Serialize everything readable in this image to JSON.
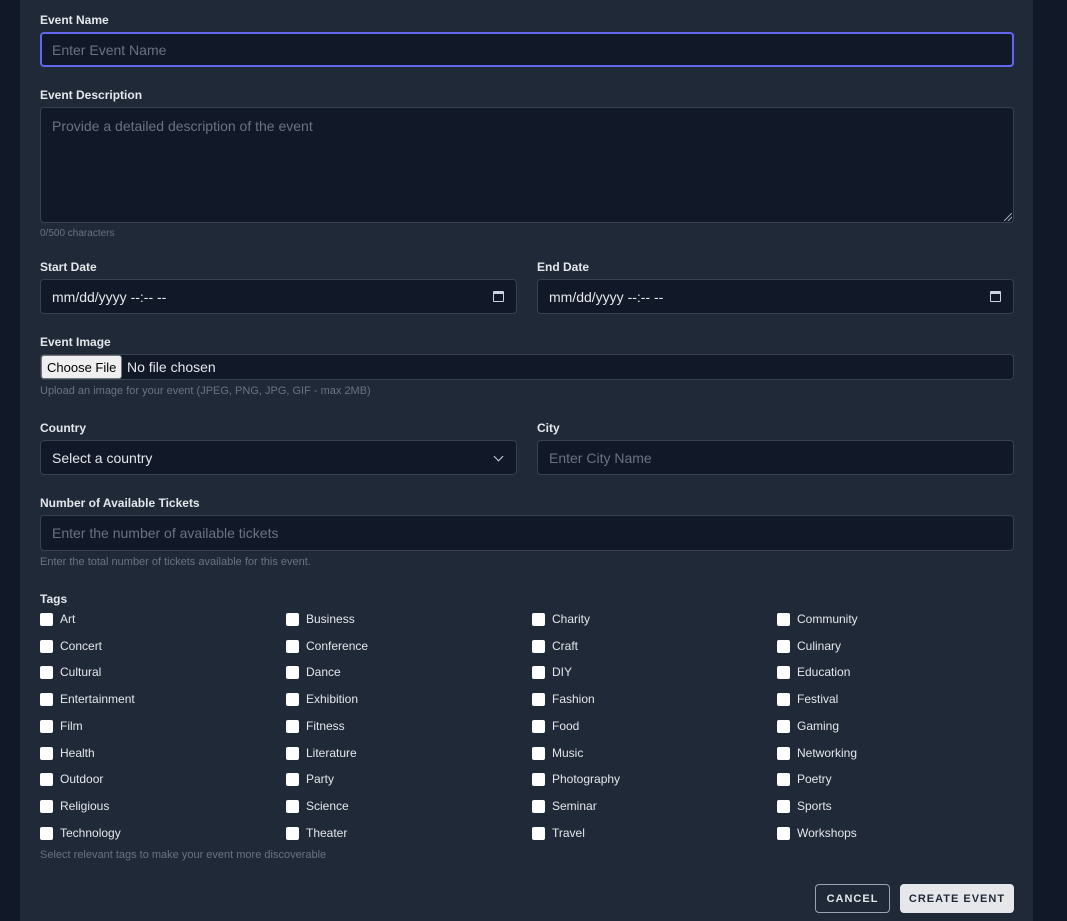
{
  "event_name": {
    "label": "Event Name",
    "placeholder": "Enter Event Name",
    "value": ""
  },
  "event_description": {
    "label": "Event Description",
    "placeholder": "Provide a detailed description of the event",
    "counter": "0/500 characters"
  },
  "start_date": {
    "label": "Start Date",
    "value": "mm/dd/yyyy --:-- --"
  },
  "end_date": {
    "label": "End Date",
    "value": "mm/dd/yyyy --:-- --"
  },
  "event_image": {
    "label": "Event Image",
    "button_label": "Choose File",
    "status": "No file chosen",
    "hint": "Upload an image for your event (JPEG, PNG, JPG, GIF - max 2MB)"
  },
  "country": {
    "label": "Country",
    "selected": "Select a country"
  },
  "city": {
    "label": "City",
    "placeholder": "Enter City Name"
  },
  "tickets": {
    "label": "Number of Available Tickets",
    "placeholder": "Enter the number of available tickets",
    "hint": "Enter the total number of tickets available for this event."
  },
  "tags": {
    "label": "Tags",
    "hint": "Select relevant tags to make your event more discoverable",
    "items": [
      "Art",
      "Business",
      "Charity",
      "Community",
      "Concert",
      "Conference",
      "Craft",
      "Culinary",
      "Cultural",
      "Dance",
      "DIY",
      "Education",
      "Entertainment",
      "Exhibition",
      "Fashion",
      "Festival",
      "Film",
      "Fitness",
      "Food",
      "Gaming",
      "Health",
      "Literature",
      "Music",
      "Networking",
      "Outdoor",
      "Party",
      "Photography",
      "Poetry",
      "Religious",
      "Science",
      "Seminar",
      "Sports",
      "Technology",
      "Theater",
      "Travel",
      "Workshops"
    ]
  },
  "actions": {
    "cancel_label": "CANCEL",
    "create_label": "CREATE EVENT"
  },
  "colors": {
    "page_background": "#111827",
    "panel_background": "#1f2937",
    "input_background": "#111827",
    "focus_accent": "#6366f1"
  },
  "icons": {
    "date": "calendar-icon",
    "select": "chevron-down-icon",
    "textarea": "resize-handle-icon"
  }
}
